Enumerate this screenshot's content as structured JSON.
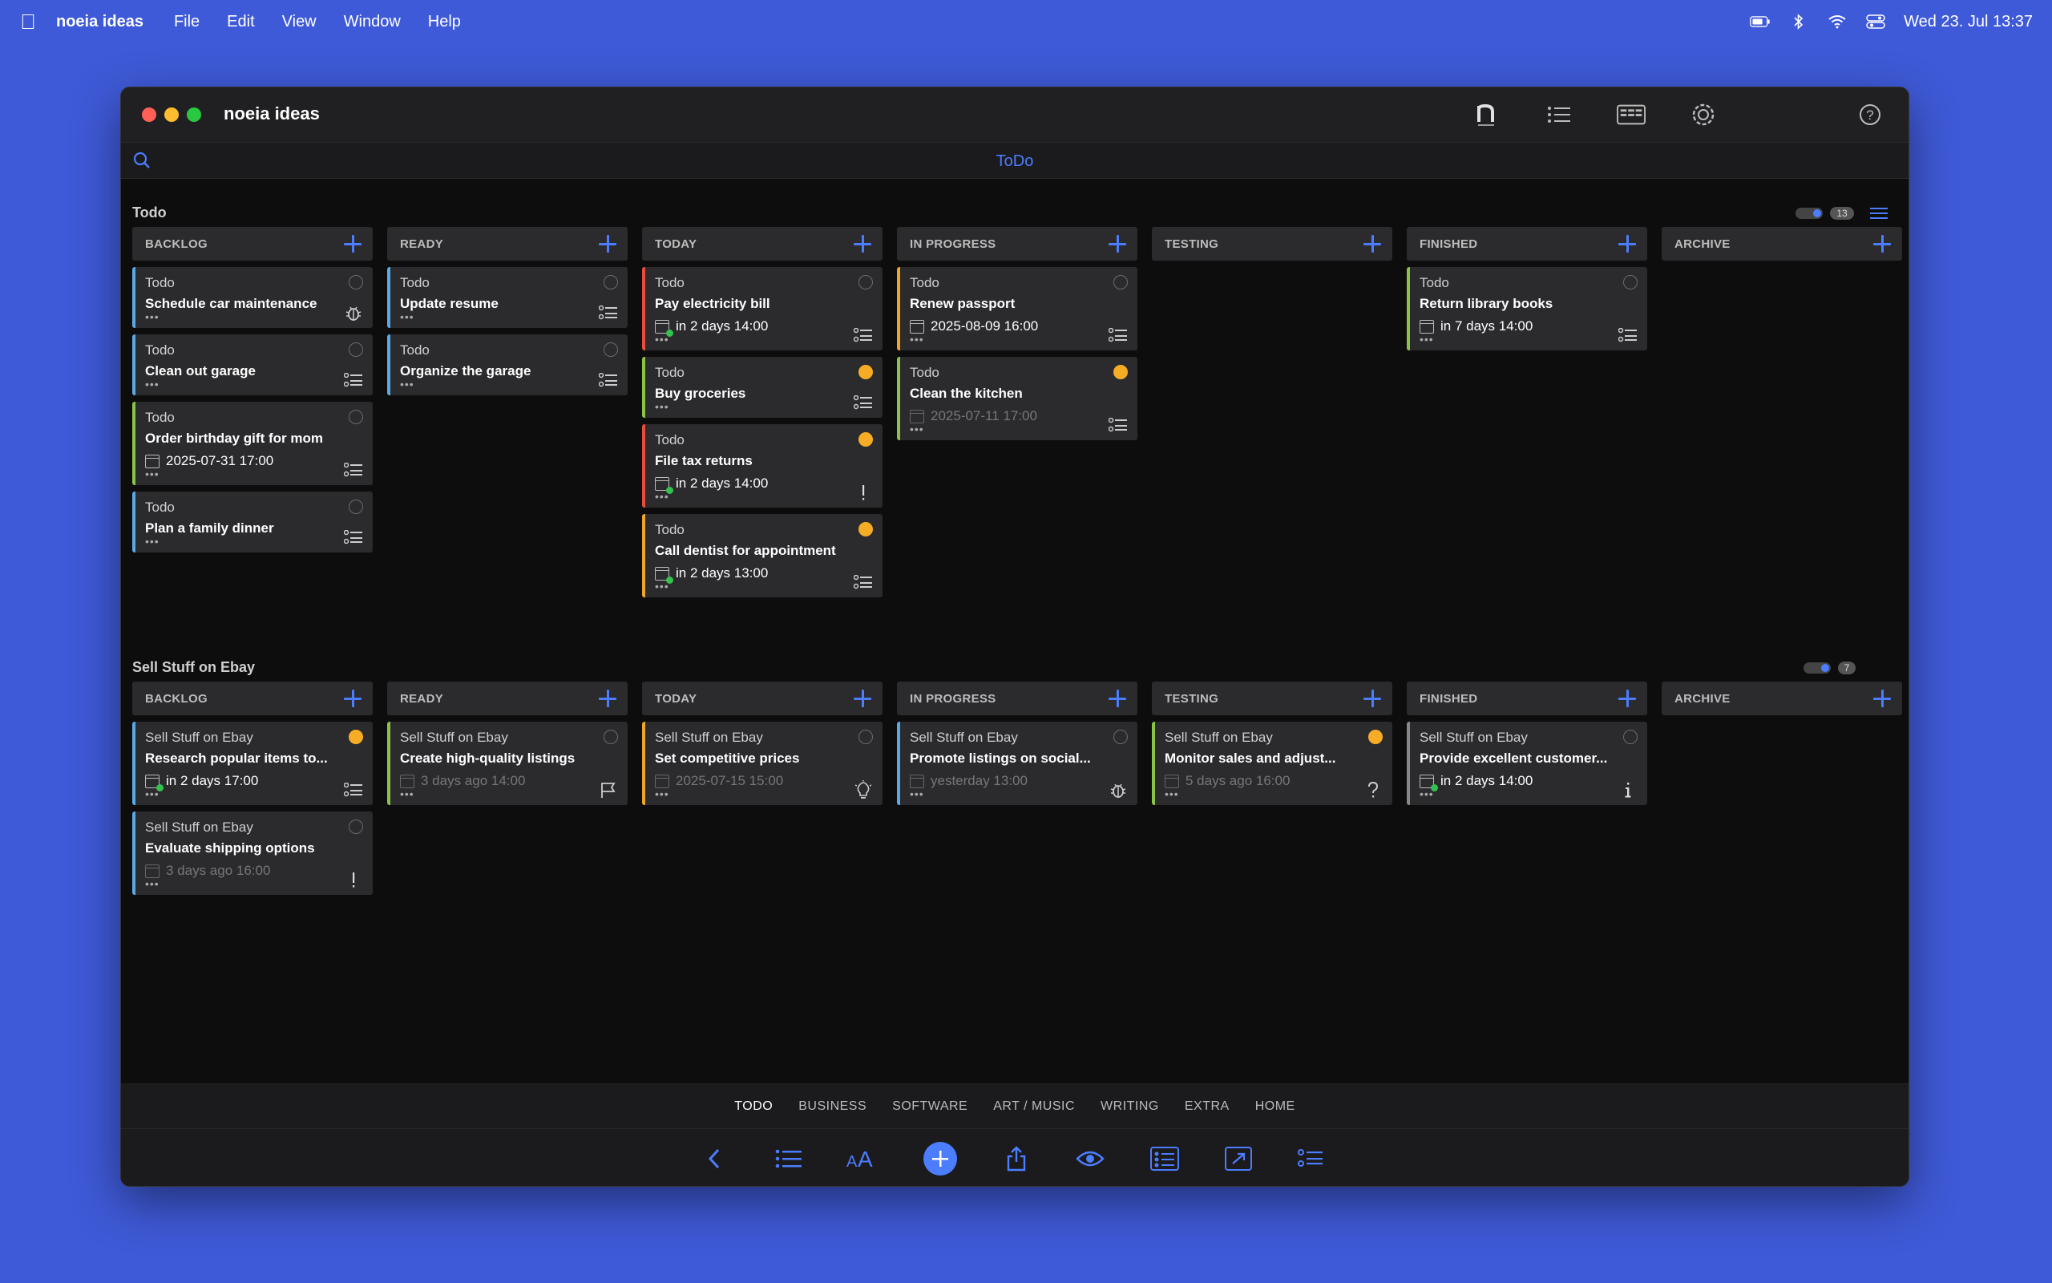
{
  "menubar": {
    "app_name": "noeia ideas",
    "menus": [
      "File",
      "Edit",
      "View",
      "Window",
      "Help"
    ],
    "clock": "Wed 23. Jul  13:37"
  },
  "window": {
    "title": "noeia ideas",
    "view_title": "ToDo",
    "toolbar_icons": [
      "logo-icon",
      "list-icon",
      "board-icon",
      "settings-icon",
      "help-icon"
    ]
  },
  "columns": [
    "BACKLOG",
    "READY",
    "TODAY",
    "IN PROGRESS",
    "TESTING",
    "FINISHED",
    "ARCHIVE"
  ],
  "boards": [
    {
      "title": "Todo",
      "count": "13",
      "cards": {
        "backlog": [
          {
            "project": "Todo",
            "title": "Schedule car maintenance",
            "state": "open",
            "type": "bug",
            "border": "blue"
          },
          {
            "project": "Todo",
            "title": "Clean out garage",
            "state": "open",
            "type": "checklist",
            "border": "blue"
          },
          {
            "project": "Todo",
            "title": "Order birthday gift for mom",
            "date": "2025-07-31 17:00",
            "date_style": "normal",
            "state": "open",
            "type": "checklist",
            "border": "green"
          },
          {
            "project": "Todo",
            "title": "Plan a family dinner",
            "state": "open",
            "type": "checklist",
            "border": "blue"
          }
        ],
        "ready": [
          {
            "project": "Todo",
            "title": "Update resume",
            "state": "open",
            "type": "checklist",
            "border": "blue"
          },
          {
            "project": "Todo",
            "title": "Organize the garage",
            "state": "open",
            "type": "checklist",
            "border": "blue"
          }
        ],
        "today": [
          {
            "project": "Todo",
            "title": "Pay electricity bill",
            "date": "in 2 days 14:00",
            "date_style": "live",
            "state": "open",
            "type": "checklist",
            "border": "red"
          },
          {
            "project": "Todo",
            "title": "Buy groceries",
            "state": "orange",
            "type": "checklist",
            "border": "green"
          },
          {
            "project": "Todo",
            "title": "File tax returns",
            "date": "in 2 days 14:00",
            "date_style": "live",
            "state": "orange",
            "type": "exclamation",
            "border": "red"
          },
          {
            "project": "Todo",
            "title": "Call dentist for appointment",
            "date": "in 2 days 13:00",
            "date_style": "live",
            "state": "orange",
            "type": "checklist",
            "border": "orange"
          }
        ],
        "in_progress": [
          {
            "project": "Todo",
            "title": "Renew passport",
            "date": "2025-08-09 16:00",
            "date_style": "normal",
            "state": "open",
            "type": "checklist",
            "border": "orange"
          },
          {
            "project": "Todo",
            "title": "Clean the kitchen",
            "date": "2025-07-11 17:00",
            "date_style": "dim",
            "state": "orange",
            "type": "checklist",
            "border": "green"
          }
        ],
        "testing": [],
        "finished": [
          {
            "project": "Todo",
            "title": "Return library books",
            "date": "in 7 days 14:00",
            "date_style": "normal",
            "state": "open",
            "type": "checklist",
            "border": "green"
          }
        ],
        "archive": []
      }
    },
    {
      "title": "Sell Stuff on Ebay",
      "count": "7",
      "cards": {
        "backlog": [
          {
            "project": "Sell Stuff on Ebay",
            "title": "Research popular items to...",
            "date": "in 2 days 17:00",
            "date_style": "live",
            "state": "orange",
            "type": "checklist",
            "border": "blue"
          },
          {
            "project": "Sell Stuff on Ebay",
            "title": "Evaluate shipping options",
            "date": "3 days ago 16:00",
            "date_style": "dim",
            "state": "open",
            "type": "exclamation",
            "border": "blue"
          }
        ],
        "ready": [
          {
            "project": "Sell Stuff on Ebay",
            "title": "Create high-quality listings",
            "date": "3 days ago 14:00",
            "date_style": "dim",
            "state": "open",
            "type": "flag",
            "border": "green"
          }
        ],
        "today": [
          {
            "project": "Sell Stuff on Ebay",
            "title": "Set competitive prices",
            "date": "2025-07-15 15:00",
            "date_style": "dim",
            "state": "open",
            "type": "idea",
            "border": "orange"
          }
        ],
        "in_progress": [
          {
            "project": "Sell Stuff on Ebay",
            "title": "Promote listings on social...",
            "date": "yesterday 13:00",
            "date_style": "dim",
            "state": "open",
            "type": "bug",
            "border": "blue"
          }
        ],
        "testing": [
          {
            "project": "Sell Stuff on Ebay",
            "title": "Monitor sales and adjust...",
            "date": "5 days ago 16:00",
            "date_style": "dim",
            "state": "orange",
            "type": "question",
            "border": "green"
          }
        ],
        "finished": [
          {
            "project": "Sell Stuff on Ebay",
            "title": "Provide excellent customer...",
            "date": "in 2 days 14:00",
            "date_style": "live",
            "state": "open",
            "type": "info",
            "border": "gray"
          }
        ],
        "archive": []
      }
    }
  ],
  "tabs": [
    "TODO",
    "BUSINESS",
    "SOFTWARE",
    "ART / MUSIC",
    "WRITING",
    "EXTRA",
    "HOME"
  ],
  "active_tab": "TODO",
  "toolbar": [
    "back-icon",
    "outline-icon",
    "font-size-icon",
    "add-icon",
    "share-icon",
    "preview-icon",
    "checklist-view-icon",
    "fullscreen-icon",
    "tasks-icon"
  ],
  "colors": {
    "accent": "#4c7dff",
    "desktop": "#3f5ad8",
    "card": "#2b2b2e",
    "state_orange": "#f6ad25",
    "border_blue": "#5aa9e6",
    "border_green": "#8bc34a",
    "border_red": "#e74c3c",
    "border_orange": "#f0a430"
  }
}
